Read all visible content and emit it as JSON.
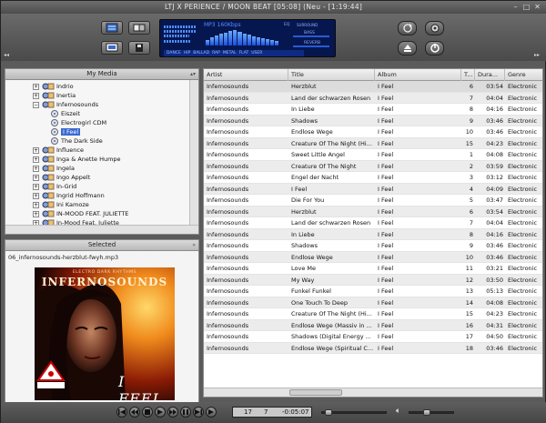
{
  "window": {
    "title": "LTJ X  PERIENCE / MOON BEAT  [05:08]  (Neu - [1:19:44]",
    "buttons": {
      "minimize": "–",
      "maximize": "□",
      "close": "✕"
    }
  },
  "display": {
    "quality": "MP3 160Kbps",
    "vu_label": "",
    "eq_label": "EQ",
    "presets": [
      "DANCE",
      "HIP",
      "BALLAD",
      "RAP",
      "METAL",
      "FLAT",
      "USER"
    ],
    "right_labels": [
      "SURROUND",
      "BASS",
      "REVERB"
    ],
    "eq_levels": [
      0.35,
      0.5,
      0.6,
      0.7,
      0.8,
      0.9,
      0.95,
      0.85,
      0.75,
      0.65,
      0.55,
      0.5,
      0.45,
      0.4,
      0.35,
      0.3
    ]
  },
  "left_pane": {
    "media_header": "My Media",
    "selected_header": "Selected",
    "selected_file": "06_infernosounds-herzblut-fwyh.mp3",
    "tree": [
      {
        "label": "Indrio",
        "level": 0,
        "expander": "+"
      },
      {
        "label": "Inertia",
        "level": 0,
        "expander": "+"
      },
      {
        "label": "Infernosounds",
        "level": 0,
        "expander": "−"
      },
      {
        "label": "Eiszeit",
        "level": 1,
        "expander": ""
      },
      {
        "label": "Electrogirl CDM",
        "level": 1,
        "expander": ""
      },
      {
        "label": "I Feel",
        "level": 1,
        "expander": "",
        "selected": true
      },
      {
        "label": "The Dark Side",
        "level": 1,
        "expander": ""
      },
      {
        "label": "Influence",
        "level": 0,
        "expander": "+"
      },
      {
        "label": "Inga & Anette Humpe",
        "level": 0,
        "expander": "+"
      },
      {
        "label": "Ingela",
        "level": 0,
        "expander": "+"
      },
      {
        "label": "Ingo Appelt",
        "level": 0,
        "expander": "+"
      },
      {
        "label": "In-Grid",
        "level": 0,
        "expander": "+"
      },
      {
        "label": "Ingrid Hoffmann",
        "level": 0,
        "expander": "+"
      },
      {
        "label": "Ini Kamoze",
        "level": 0,
        "expander": "+"
      },
      {
        "label": "IN-MOOD FEAT. JULIETTE",
        "level": 0,
        "expander": "+"
      },
      {
        "label": "In-Mood Feat. Juliette",
        "level": 0,
        "expander": "+"
      }
    ],
    "album_art": {
      "band_name": "INFERNOSOUNDS",
      "tagline": "ELECTRO DARK RHYTHMS",
      "album_title": "I FEEL"
    }
  },
  "playlist": {
    "columns": [
      "Artist",
      "Title",
      "Album",
      "T...",
      "Dura...",
      "Genre"
    ],
    "rows": [
      {
        "artist": "Infernosounds",
        "title": "Herzblut",
        "album": "I Feel",
        "track": "6",
        "duration": "03:54",
        "genre": "Electronic"
      },
      {
        "artist": "Infernosounds",
        "title": "Land der schwarzen Rosen",
        "album": "I Feel",
        "track": "7",
        "duration": "04:04",
        "genre": "Electronic"
      },
      {
        "artist": "Infernosounds",
        "title": "In Liebe",
        "album": "I Feel",
        "track": "8",
        "duration": "04:16",
        "genre": "Electronic"
      },
      {
        "artist": "Infernosounds",
        "title": "Shadows",
        "album": "I Feel",
        "track": "9",
        "duration": "03:46",
        "genre": "Electronic"
      },
      {
        "artist": "Infernosounds",
        "title": "Endlose Wege",
        "album": "I Feel",
        "track": "10",
        "duration": "03:46",
        "genre": "Electronic"
      },
      {
        "artist": "Infernosounds",
        "title": "Creature Of The Night (Hi...",
        "album": "I Feel",
        "track": "15",
        "duration": "04:23",
        "genre": "Electronic"
      },
      {
        "artist": "Infernosounds",
        "title": "Sweet Little Angel",
        "album": "I Feel",
        "track": "1",
        "duration": "04:08",
        "genre": "Electronic"
      },
      {
        "artist": "Infernosounds",
        "title": "Creature Of The Night",
        "album": "I Feel",
        "track": "2",
        "duration": "03:59",
        "genre": "Electronic"
      },
      {
        "artist": "Infernosounds",
        "title": "Engel der Nacht",
        "album": "I Feel",
        "track": "3",
        "duration": "03:12",
        "genre": "Electronic"
      },
      {
        "artist": "Infernosounds",
        "title": "I Feel",
        "album": "I Feel",
        "track": "4",
        "duration": "04:09",
        "genre": "Electronic"
      },
      {
        "artist": "Infernosounds",
        "title": "Die For You",
        "album": "I Feel",
        "track": "5",
        "duration": "03:47",
        "genre": "Electronic"
      },
      {
        "artist": "Infernosounds",
        "title": "Herzblut",
        "album": "I Feel",
        "track": "6",
        "duration": "03:54",
        "genre": "Electronic"
      },
      {
        "artist": "Infernosounds",
        "title": "Land der schwarzen Rosen",
        "album": "I Feel",
        "track": "7",
        "duration": "04:04",
        "genre": "Electronic"
      },
      {
        "artist": "Infernosounds",
        "title": "In Liebe",
        "album": "I Feel",
        "track": "8",
        "duration": "04:16",
        "genre": "Electronic"
      },
      {
        "artist": "Infernosounds",
        "title": "Shadows",
        "album": "I Feel",
        "track": "9",
        "duration": "03:46",
        "genre": "Electronic"
      },
      {
        "artist": "Infernosounds",
        "title": "Endlose Wege",
        "album": "I Feel",
        "track": "10",
        "duration": "03:46",
        "genre": "Electronic"
      },
      {
        "artist": "Infernosounds",
        "title": "Love Me",
        "album": "I Feel",
        "track": "11",
        "duration": "03:21",
        "genre": "Electronic"
      },
      {
        "artist": "Infernosounds",
        "title": "My Way",
        "album": "I Feel",
        "track": "12",
        "duration": "03:50",
        "genre": "Electronic"
      },
      {
        "artist": "Infernosounds",
        "title": "Funkel Funkel",
        "album": "I Feel",
        "track": "13",
        "duration": "05:13",
        "genre": "Electronic"
      },
      {
        "artist": "Infernosounds",
        "title": "One Touch To Deep",
        "album": "I Feel",
        "track": "14",
        "duration": "04:08",
        "genre": "Electronic"
      },
      {
        "artist": "Infernosounds",
        "title": "Creature Of The Night (Hi...",
        "album": "I Feel",
        "track": "15",
        "duration": "04:23",
        "genre": "Electronic"
      },
      {
        "artist": "Infernosounds",
        "title": "Endlose Wege (Massiv in ...",
        "album": "I Feel",
        "track": "16",
        "duration": "04:31",
        "genre": "Electronic"
      },
      {
        "artist": "Infernosounds",
        "title": "Shadows (Digital Energy ...",
        "album": "I Feel",
        "track": "17",
        "duration": "04:50",
        "genre": "Electronic"
      },
      {
        "artist": "Infernosounds",
        "title": "Endlose Wege (Spiritual C...",
        "album": "I Feel",
        "track": "18",
        "duration": "03:46",
        "genre": "Electronic"
      }
    ]
  },
  "transport": {
    "track_number": "17",
    "position": "7",
    "time": "-0:05:07",
    "seek_level": 0.05,
    "volume_level": 0.35
  },
  "colors": {
    "selection": "#3a6ad0",
    "display_bg": "#06164f",
    "display_text": "#5a8dff"
  }
}
